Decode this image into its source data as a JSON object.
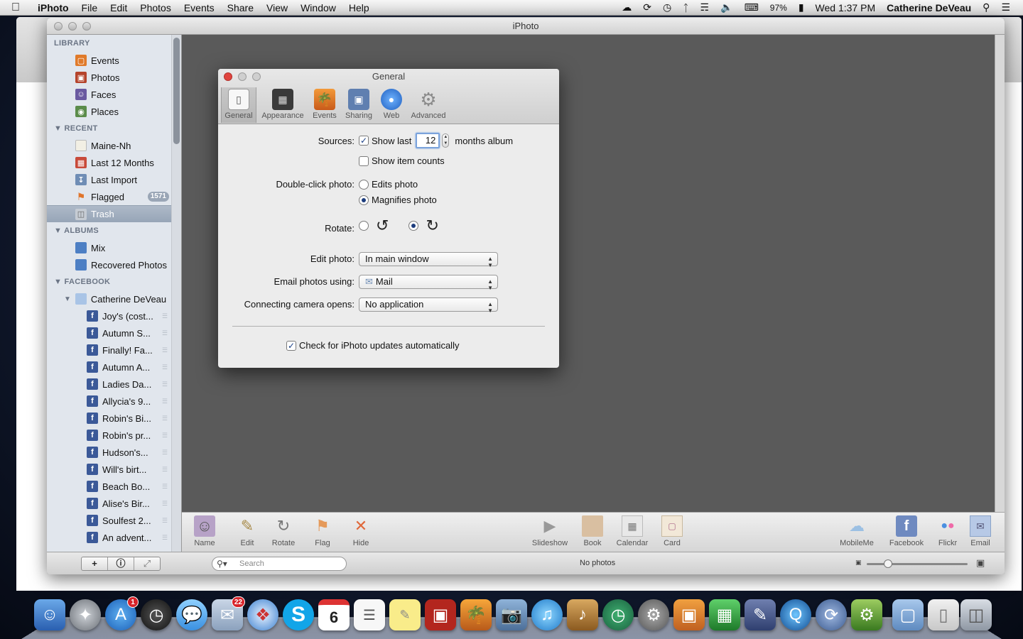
{
  "menubar": {
    "app": "iPhoto",
    "menus": [
      "File",
      "Edit",
      "Photos",
      "Events",
      "Share",
      "View",
      "Window",
      "Help"
    ],
    "battery": "97%",
    "clock": "Wed 1:37 PM",
    "user": "Catherine DeVeau"
  },
  "window": {
    "title": "iPhoto"
  },
  "sidebar": {
    "library": {
      "header": "LIBRARY",
      "items": [
        "Events",
        "Photos",
        "Faces",
        "Places"
      ]
    },
    "recent": {
      "header": "RECENT",
      "items": [
        "Maine-Nh",
        "Last 12 Months",
        "Last Import",
        "Flagged",
        "Trash"
      ],
      "flagged_badge": "1571"
    },
    "albums": {
      "header": "ALBUMS",
      "items": [
        "Mix",
        "Recovered Photos"
      ]
    },
    "facebook": {
      "header": "FACEBOOK",
      "account": "Catherine DeVeau",
      "items": [
        "Joy's (cost...",
        "Autumn S...",
        "Finally! Fa...",
        "Autumn A...",
        "Ladies Da...",
        "Allycia's 9...",
        "Robin's Bi...",
        "Robin's pr...",
        "Hudson's...",
        "Will's birt...",
        "Beach Bo...",
        "Alise's Bir...",
        "Soulfest 2...",
        "An advent..."
      ]
    }
  },
  "toolbar": {
    "left": [
      "Name",
      "Edit",
      "Rotate",
      "Flag",
      "Hide"
    ],
    "middle": [
      "Slideshow",
      "Book",
      "Calendar",
      "Card"
    ],
    "right": [
      "MobileMe",
      "Facebook",
      "Flickr",
      "Email"
    ]
  },
  "statusbar": {
    "search_placeholder": "Search",
    "status": "No photos"
  },
  "prefs": {
    "title": "General",
    "tabs": [
      "General",
      "Appearance",
      "Events",
      "Sharing",
      "Web",
      "Advanced"
    ],
    "sources_label": "Sources:",
    "show_last_label": "Show last",
    "months_value": "12",
    "months_suffix": "months album",
    "show_item_counts_label": "Show item counts",
    "double_click_label": "Double-click photo:",
    "edits_photo_label": "Edits photo",
    "magnifies_photo_label": "Magnifies photo",
    "rotate_label": "Rotate:",
    "edit_photo_label": "Edit photo:",
    "edit_photo_value": "In main window",
    "email_label": "Email photos using:",
    "email_value": "Mail",
    "camera_label": "Connecting camera opens:",
    "camera_value": "No application",
    "check_updates_label": "Check for iPhoto updates automatically"
  },
  "dock": {
    "app_store_badge": "1",
    "mail_badge": "22",
    "calendar_day": "6"
  },
  "colors": {
    "fb_blue": "#3b5998",
    "selection": "#9aa7b8",
    "close_red": "#e0443e",
    "minimize": "#bdbdbd"
  }
}
